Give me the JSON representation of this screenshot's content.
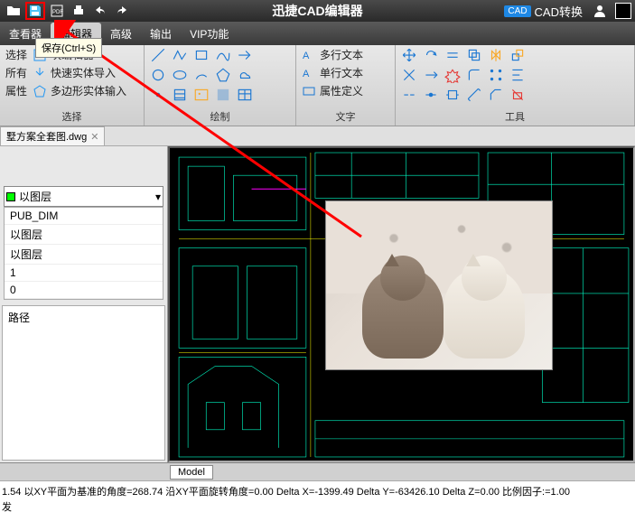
{
  "app": {
    "title": "迅捷CAD编辑器",
    "convert": "CAD转换"
  },
  "tooltip": "保存(Ctrl+S)",
  "tabs": {
    "viewer": "查看器",
    "editor": "编辑器",
    "advanced": "高级",
    "output": "输出",
    "vip": "VIP功能"
  },
  "ribbon": {
    "select": {
      "label": "选择",
      "row1": "选择",
      "row2": "所有",
      "row3": "属性",
      "editor": "块编辑器",
      "import": "快速实体导入",
      "poly": "多边形实体输入"
    },
    "draw": {
      "label": "绘制"
    },
    "text": {
      "label": "文字",
      "multi": "多行文本",
      "single": "单行文本",
      "attr": "属性定义"
    },
    "tool": {
      "label": "工具"
    }
  },
  "filetab": {
    "name": "墅方案全套图.dwg"
  },
  "panel": {
    "combo": "以图层",
    "rows": [
      "PUB_DIM",
      "以图层",
      "以图层",
      "1",
      "0"
    ],
    "path_label": "路径"
  },
  "model_tab": "Model",
  "status": {
    "line1": "1.54 以XY平面为基准的角度=268.74  沿XY平面旋转角度=0.00  Delta X=-1399.49  Delta Y=-63426.10  Delta Z=0.00  比例因子:=1.00",
    "line2": "发"
  }
}
